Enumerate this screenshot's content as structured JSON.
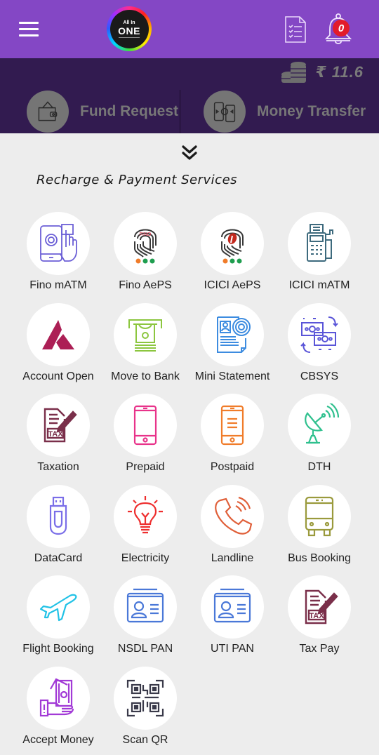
{
  "header": {
    "menu_icon": "hamburger-menu-icon",
    "logo": {
      "top_text": "All In",
      "main_text": "ONE"
    },
    "report_icon": "document-checklist-icon",
    "notification_icon": "bell-icon",
    "notification_count": "0"
  },
  "wallet": {
    "icon": "coins-stack-icon",
    "balance": "₹ 11.6"
  },
  "quick_actions": [
    {
      "label": "Fund Request",
      "icon": "wallet-icon"
    },
    {
      "label": "Money Transfer",
      "icon": "phone-transfer-icon"
    }
  ],
  "collapse_icon": "double-chevron-down-icon",
  "section": {
    "title": "Recharge & Payment Services"
  },
  "services": [
    {
      "label": "Fino mATM",
      "icon": "fingerprint-phone-icon",
      "color": "#6b5fd6"
    },
    {
      "label": "Fino AePS",
      "icon": "fingerprint-fino-icon",
      "color": "#3a3a3a"
    },
    {
      "label": "ICICI AePS",
      "icon": "fingerprint-icici-icon",
      "color": "#3a3a3a"
    },
    {
      "label": "ICICI mATM",
      "icon": "pos-terminal-icon",
      "color": "#3d6a7d"
    },
    {
      "label": "Account Open",
      "icon": "axis-bank-icon",
      "color": "#ac1f55"
    },
    {
      "label": "Move to Bank",
      "icon": "atm-cash-icon",
      "color": "#8cc63f"
    },
    {
      "label": "Mini Statement",
      "icon": "statement-fingerprint-icon",
      "color": "#3d8ce0"
    },
    {
      "label": "CBSYS",
      "icon": "money-exchange-icon",
      "color": "#5a55d8"
    },
    {
      "label": "Taxation",
      "icon": "tax-form-icon",
      "color": "#7a2f4a"
    },
    {
      "label": "Prepaid",
      "icon": "smartphone-icon",
      "color": "#e8338a"
    },
    {
      "label": "Postpaid",
      "icon": "smartphone-bill-icon",
      "color": "#f07c2a"
    },
    {
      "label": "DTH",
      "icon": "satellite-dish-icon",
      "color": "#2fc08e"
    },
    {
      "label": "DataCard",
      "icon": "usb-drive-icon",
      "color": "#7a6ee8"
    },
    {
      "label": "Electricity",
      "icon": "light-bulb-icon",
      "color": "#ee2e2e"
    },
    {
      "label": "Landline",
      "icon": "telephone-icon",
      "color": "#e0603a"
    },
    {
      "label": "Bus Booking",
      "icon": "bus-icon",
      "color": "#9a9a3c"
    },
    {
      "label": "Flight Booking",
      "icon": "airplane-icon",
      "color": "#22c2e6"
    },
    {
      "label": "NSDL PAN",
      "icon": "id-card-icon",
      "color": "#4a78d8"
    },
    {
      "label": "UTI PAN",
      "icon": "id-card-icon",
      "color": "#4a78d8"
    },
    {
      "label": "Tax Pay",
      "icon": "tax-form-icon",
      "color": "#7a2f4a"
    },
    {
      "label": "Accept Money",
      "icon": "hand-cash-icon",
      "color": "#a23ad6"
    },
    {
      "label": "Scan QR",
      "icon": "qr-code-icon",
      "color": "#3a3a4a"
    }
  ],
  "colors": {
    "header_bg": "#8447c5",
    "band_bg": "#321b50",
    "content_bg": "#ededed",
    "badge": "#e21b2a"
  }
}
